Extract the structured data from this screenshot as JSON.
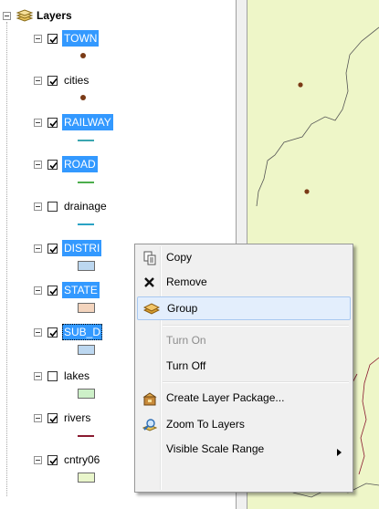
{
  "toc": {
    "root_label": "Layers",
    "layers": [
      {
        "label": "TOWN",
        "checked": true,
        "selected": true,
        "symbol": "dot"
      },
      {
        "label": "cities",
        "checked": true,
        "selected": false,
        "symbol": "dot"
      },
      {
        "label": "RAILWAY",
        "checked": true,
        "selected": true,
        "symbol": "line",
        "color": "#3aa6b0"
      },
      {
        "label": "ROAD",
        "checked": true,
        "selected": true,
        "symbol": "line",
        "color": "#4cae4c"
      },
      {
        "label": "drainage",
        "checked": false,
        "selected": false,
        "symbol": "line",
        "color": "#2aa3c4"
      },
      {
        "label": "DISTRI",
        "checked": true,
        "selected": true,
        "symbol": "poly",
        "color": "#bcd7f0"
      },
      {
        "label": "STATE",
        "checked": true,
        "selected": true,
        "symbol": "poly",
        "color": "#f3d4bd"
      },
      {
        "label": "SUB_D",
        "checked": true,
        "selected": true,
        "symbol": "poly",
        "color": "#bcd7f0"
      },
      {
        "label": "lakes",
        "checked": false,
        "selected": false,
        "symbol": "poly",
        "color": "#cdf0c8"
      },
      {
        "label": "rivers",
        "checked": true,
        "selected": false,
        "symbol": "line",
        "color": "#8a1a30"
      },
      {
        "label": "cntry06",
        "checked": true,
        "selected": false,
        "symbol": "poly",
        "color": "#e9f6cb"
      }
    ]
  },
  "context_menu": {
    "items": [
      {
        "label": "Copy",
        "icon": "copy-icon",
        "enabled": true
      },
      {
        "label": "Remove",
        "icon": "remove-x-icon",
        "enabled": true
      },
      {
        "label": "Group",
        "icon": "group-layer-icon",
        "enabled": true,
        "highlighted": true
      },
      {
        "label": "Turn On",
        "icon": "",
        "enabled": false
      },
      {
        "label": "Turn Off",
        "icon": "",
        "enabled": true
      },
      {
        "label": "Create Layer Package...",
        "icon": "layer-package-icon",
        "enabled": true
      },
      {
        "label": "Zoom To Layers",
        "icon": "zoom-to-layers-icon",
        "enabled": true
      },
      {
        "label": "Visible Scale Range",
        "icon": "",
        "enabled": true,
        "submenu": true
      }
    ]
  }
}
